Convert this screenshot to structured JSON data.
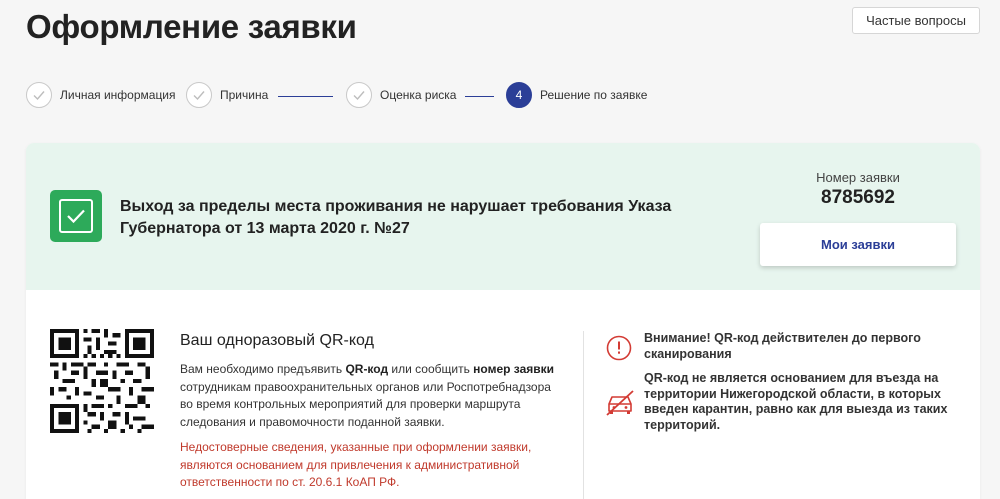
{
  "header": {
    "title": "Оформление заявки",
    "faq_label": "Частые вопросы"
  },
  "steps": [
    {
      "label": "Личная информация",
      "state": "done"
    },
    {
      "label": "Причина",
      "state": "done"
    },
    {
      "label": "Оценка риска",
      "state": "done"
    },
    {
      "label": "Решение по заявке",
      "state": "active",
      "number": "4"
    }
  ],
  "result": {
    "message": "Выход за пределы места проживания не нарушает требования Указа Губернатора от 13 марта 2020 г. №27",
    "number_label": "Номер заявки",
    "number_value": "8785692",
    "my_requests_label": "Мои заявки"
  },
  "qr": {
    "title": "Ваш одноразовый QR-код",
    "desc_part1": "Вам необходимо предъявить ",
    "desc_bold1": "QR-код",
    "desc_part2": " или сообщить ",
    "desc_bold2": "номер заявки",
    "desc_part3": " сотрудникам правоохранительных органов или Роспотребнадзора во время контрольных мероприятий для проверки маршрута следования и правомочности поданной заявки.",
    "warning": "Недостоверные сведения, указанные при оформлении заявки, являются основанием для привлечения к административной ответственности по ст. 20.6.1 КоАП РФ."
  },
  "notices": {
    "alert": "Внимание! QR-код действителен до первого сканирования",
    "car": "QR-код не является основанием для въезда на территории Нижегородской области, в которых введен карантин, равно как для выезда из таких территорий."
  },
  "colors": {
    "accent": "#2b3e97",
    "success": "#2daa5a",
    "banner_bg": "#e7f5ee",
    "warning_text": "#c0392b",
    "alert_icon": "#d33b34"
  }
}
